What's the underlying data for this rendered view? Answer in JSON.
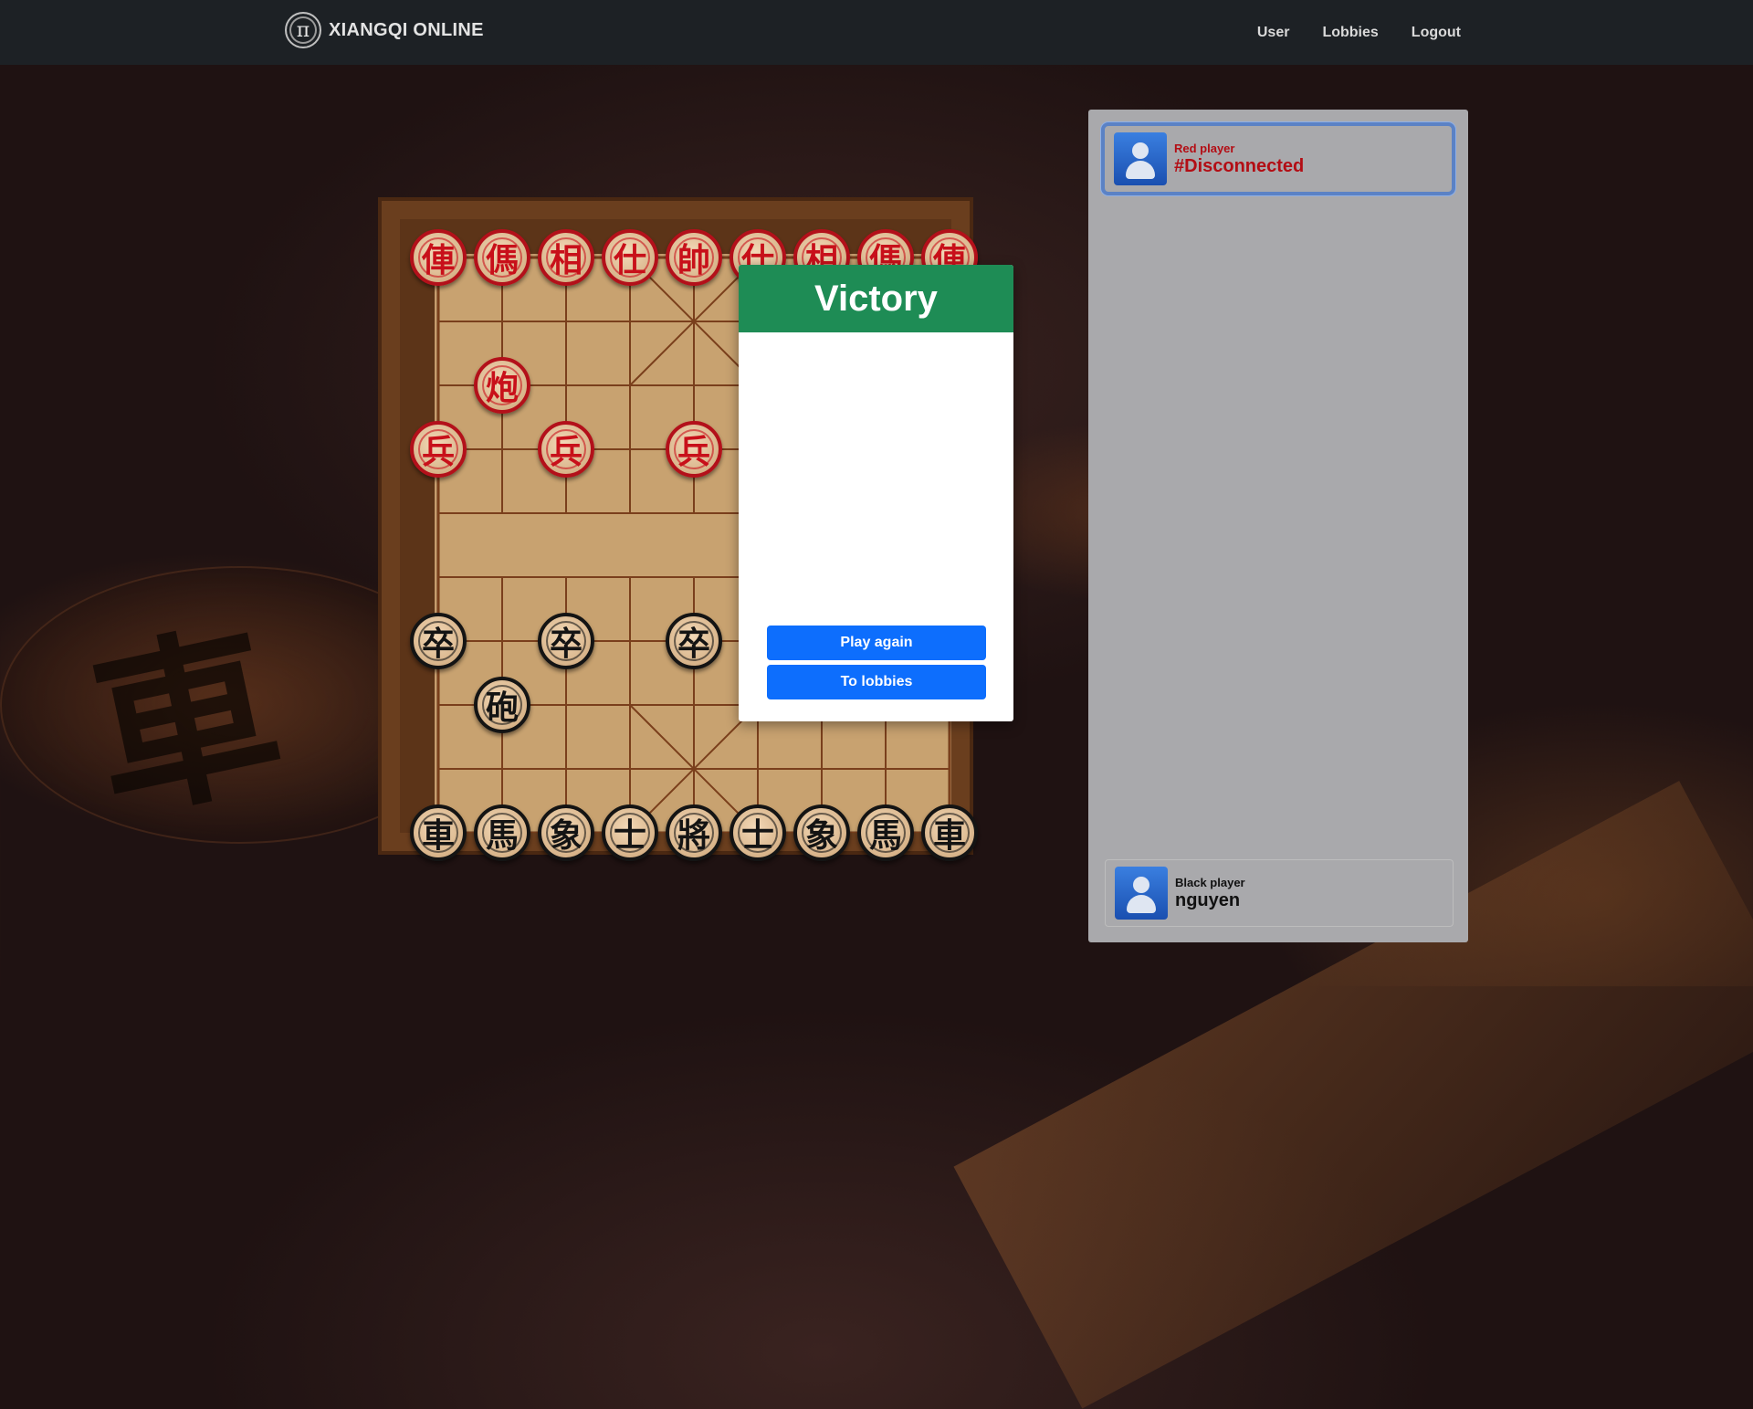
{
  "navbar": {
    "brand_icon": "π",
    "brand_name": "XIANGQI ONLINE",
    "links": [
      {
        "label": "User"
      },
      {
        "label": "Lobbies"
      },
      {
        "label": "Logout"
      }
    ]
  },
  "board": {
    "pieces": [
      {
        "side": "red",
        "char": "俥",
        "col": 0,
        "row": 0
      },
      {
        "side": "red",
        "char": "傌",
        "col": 1,
        "row": 0
      },
      {
        "side": "red",
        "char": "相",
        "col": 2,
        "row": 0
      },
      {
        "side": "red",
        "char": "仕",
        "col": 3,
        "row": 0
      },
      {
        "side": "red",
        "char": "帥",
        "col": 4,
        "row": 0
      },
      {
        "side": "red",
        "char": "仕",
        "col": 5,
        "row": 0
      },
      {
        "side": "red",
        "char": "相",
        "col": 6,
        "row": 0
      },
      {
        "side": "red",
        "char": "傌",
        "col": 7,
        "row": 0
      },
      {
        "side": "red",
        "char": "俥",
        "col": 8,
        "row": 0
      },
      {
        "side": "red",
        "char": "炮",
        "col": 1,
        "row": 2
      },
      {
        "side": "red",
        "char": "兵",
        "col": 0,
        "row": 3
      },
      {
        "side": "red",
        "char": "兵",
        "col": 2,
        "row": 3
      },
      {
        "side": "red",
        "char": "兵",
        "col": 4,
        "row": 3
      },
      {
        "side": "black",
        "char": "卒",
        "col": 0,
        "row": 6
      },
      {
        "side": "black",
        "char": "卒",
        "col": 2,
        "row": 6
      },
      {
        "side": "black",
        "char": "卒",
        "col": 4,
        "row": 6
      },
      {
        "side": "black",
        "char": "砲",
        "col": 1,
        "row": 7
      },
      {
        "side": "black",
        "char": "車",
        "col": 0,
        "row": 9
      },
      {
        "side": "black",
        "char": "馬",
        "col": 1,
        "row": 9
      },
      {
        "side": "black",
        "char": "象",
        "col": 2,
        "row": 9
      },
      {
        "side": "black",
        "char": "士",
        "col": 3,
        "row": 9
      },
      {
        "side": "black",
        "char": "將",
        "col": 4,
        "row": 9
      },
      {
        "side": "black",
        "char": "士",
        "col": 5,
        "row": 9
      },
      {
        "side": "black",
        "char": "象",
        "col": 6,
        "row": 9
      },
      {
        "side": "black",
        "char": "馬",
        "col": 7,
        "row": 9
      },
      {
        "side": "black",
        "char": "車",
        "col": 8,
        "row": 9
      }
    ]
  },
  "modal": {
    "title": "Victory",
    "play_again_label": "Play again",
    "to_lobbies_label": "To lobbies"
  },
  "players": {
    "red": {
      "role": "Red player",
      "name": "#Disconnected"
    },
    "black": {
      "role": "Black player",
      "name": "nguyen"
    }
  },
  "colors": {
    "victory_header": "#1e8c55",
    "primary_button": "#0d6efd",
    "red_piece": "#c8101a",
    "active_player_border": "#5b82c5"
  },
  "background_icon": "chariot-piece-icon"
}
